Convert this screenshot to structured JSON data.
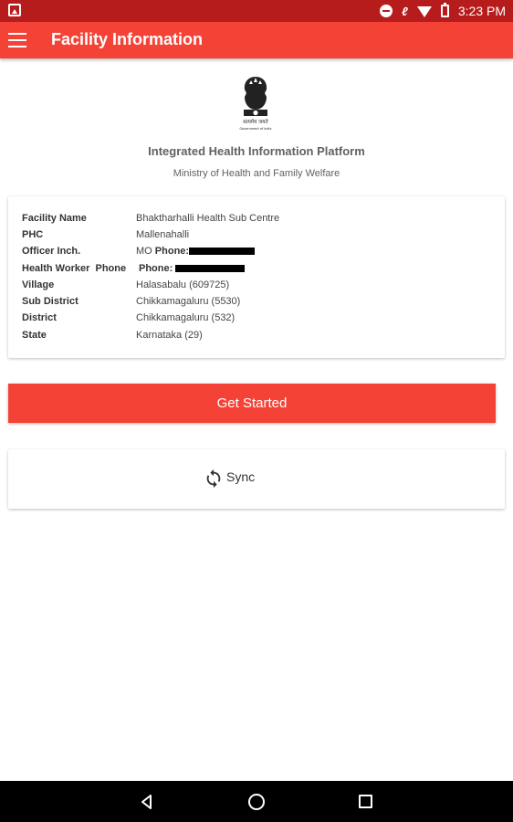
{
  "status_bar": {
    "time": "3:23 PM"
  },
  "app_bar": {
    "title": "Facility Information"
  },
  "header": {
    "emblem_caption": "सत्यमेव जयते",
    "emblem_subcaption": "Government of India",
    "platform_title": "Integrated Health Information Platform",
    "ministry": "Ministry of Health and Family Welfare"
  },
  "facility": {
    "rows": [
      {
        "label": "Facility Name",
        "value": "Bhaktharhalli Health Sub Centre"
      },
      {
        "label": "PHC",
        "value": "Mallenahalli"
      },
      {
        "label": "Officer Inch.",
        "value": "MO",
        "phone_label": "Phone:"
      },
      {
        "label": "Health Worker",
        "value": "Phone",
        "phone_label": "Phone:"
      },
      {
        "label": "Village",
        "value": "Halasabalu (609725)"
      },
      {
        "label": "Sub District",
        "value": "Chikkamagaluru (5530)"
      },
      {
        "label": "District",
        "value": "Chikkamagaluru (532)"
      },
      {
        "label": "State",
        "value": "Karnataka (29)"
      }
    ]
  },
  "actions": {
    "get_started": "Get Started",
    "sync": "Sync"
  },
  "icons": {
    "menu": "hamburger-menu-icon",
    "sync": "sync-icon",
    "back": "back-icon",
    "home": "home-icon",
    "recent": "recent-apps-icon"
  },
  "colors": {
    "primary": "#f44336",
    "status_bar": "#b71c1c"
  }
}
